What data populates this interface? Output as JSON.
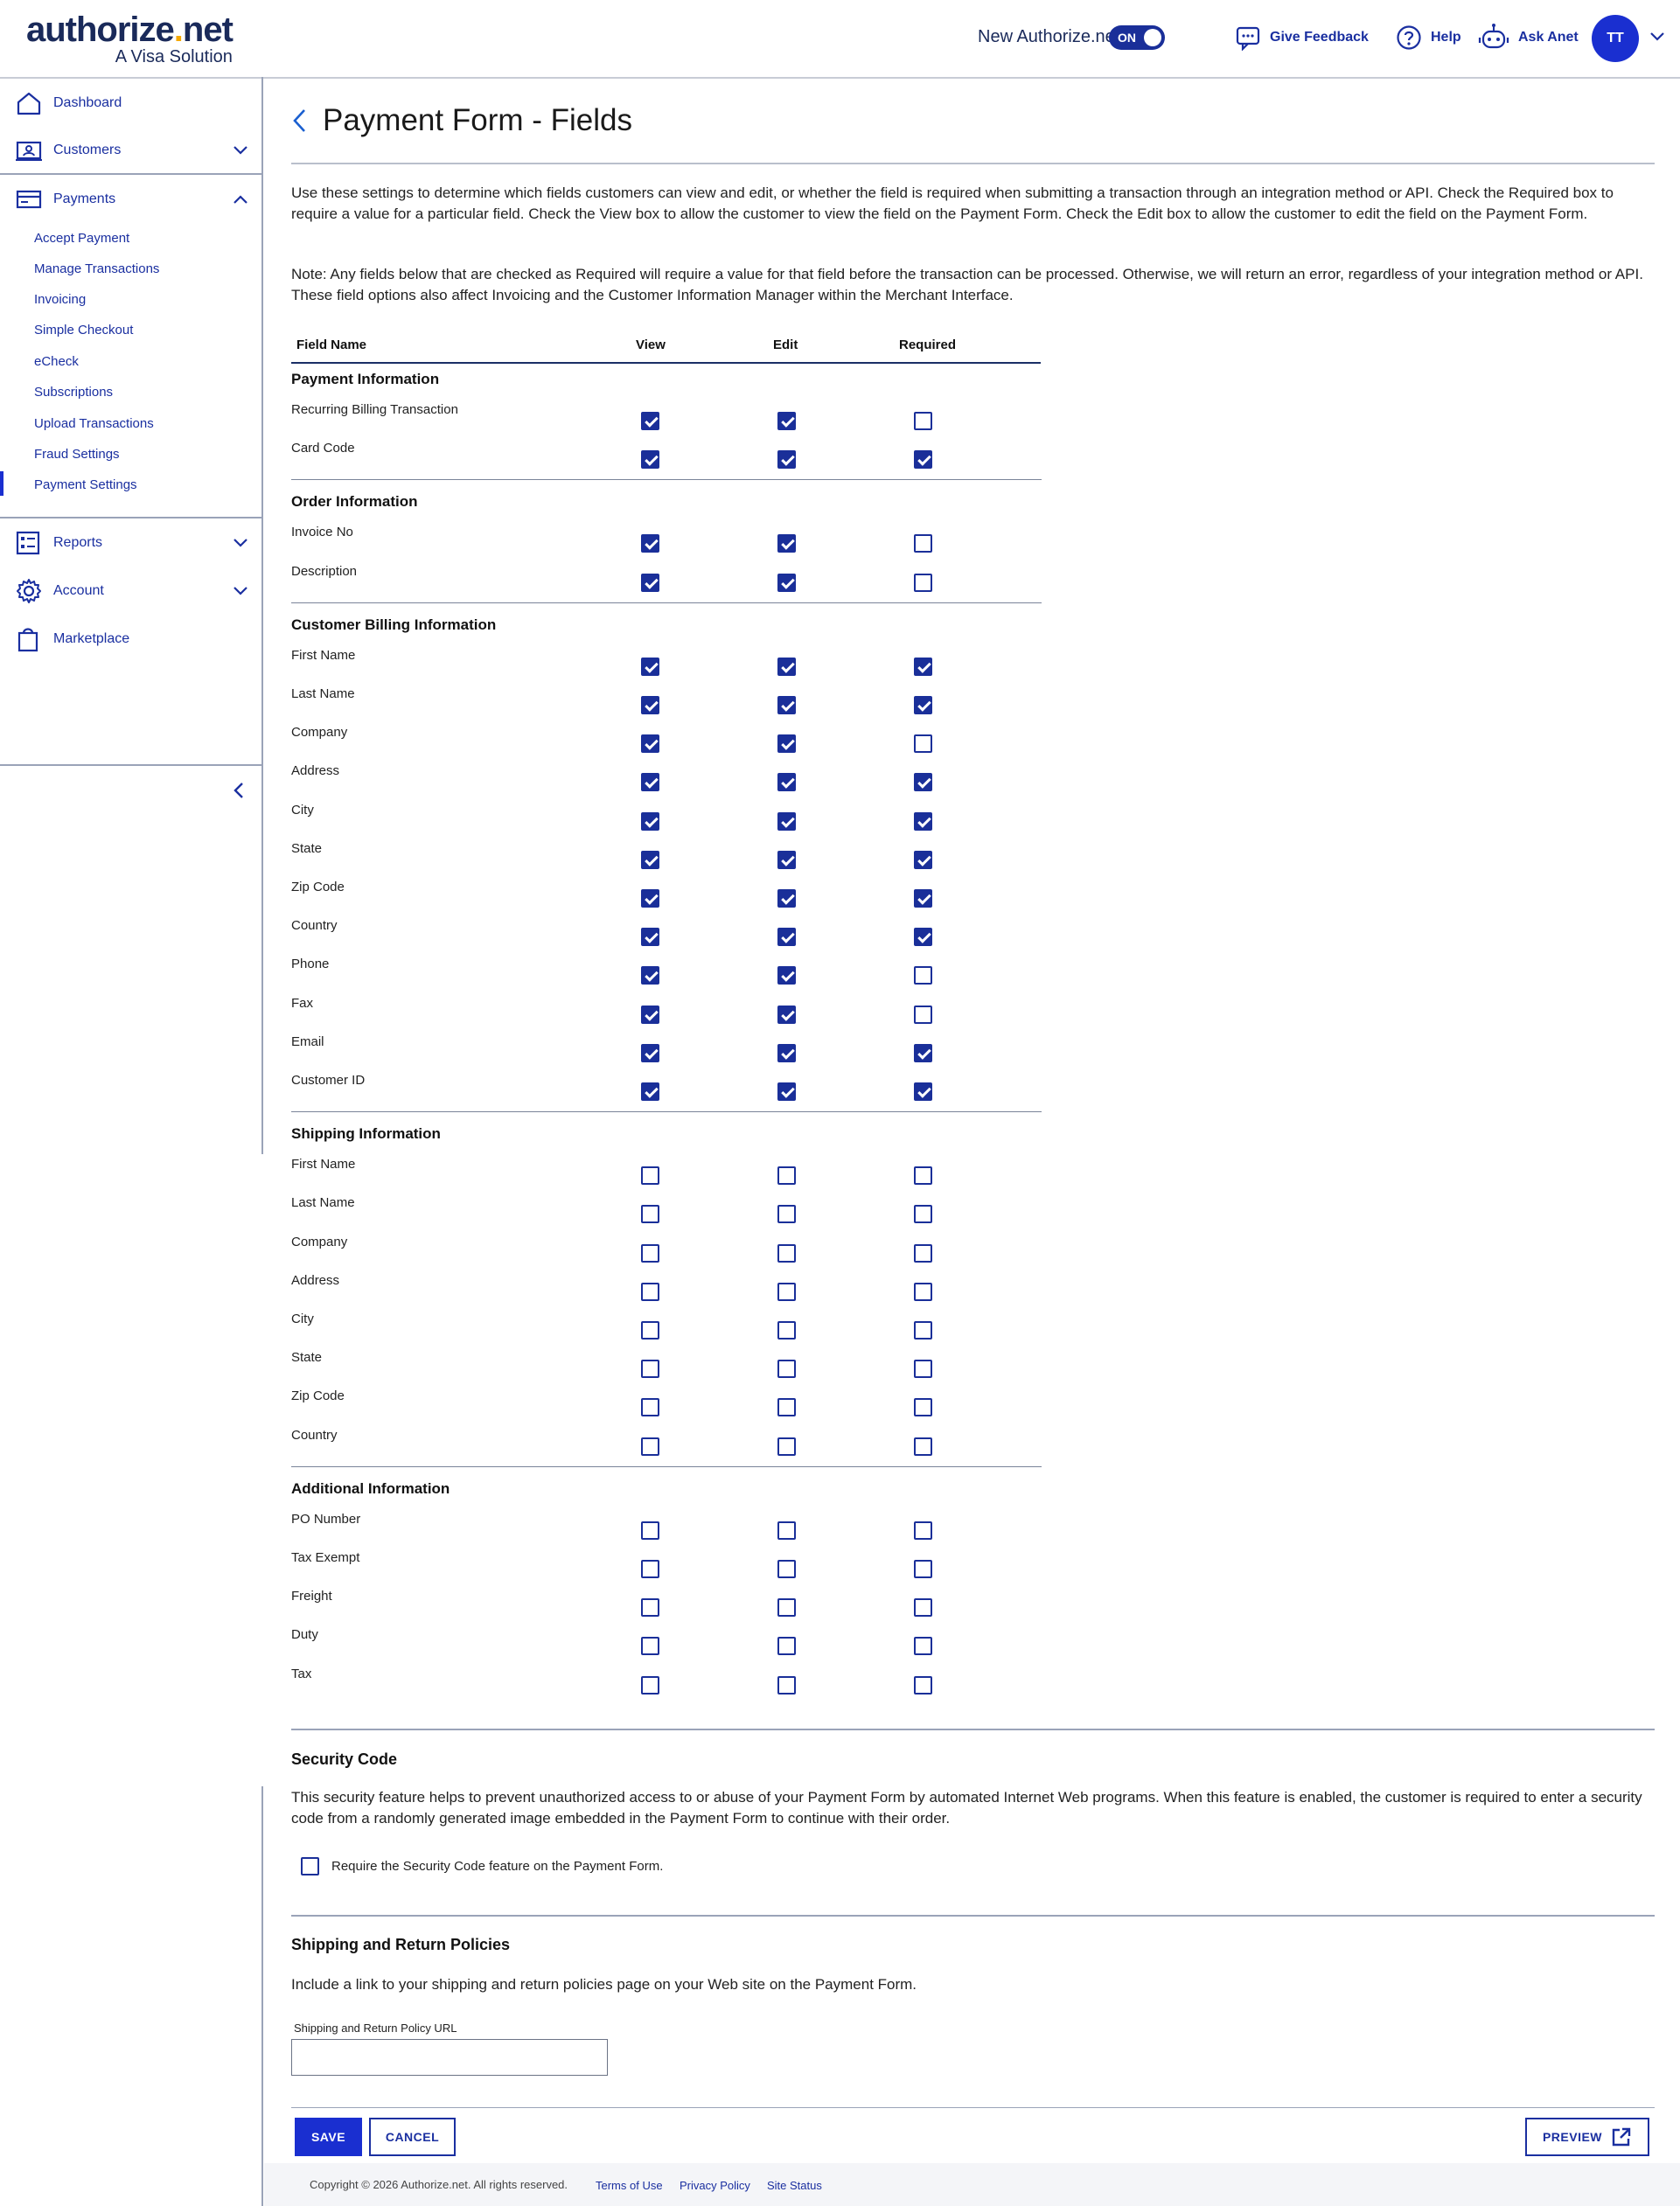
{
  "brand": {
    "name_part1": "authorize",
    "name_dot": ".",
    "name_part2": "net",
    "tagline": "A Visa Solution"
  },
  "topbar": {
    "new_label": "New Authorize.net",
    "toggle_label": "ON",
    "feedback": "Give Feedback",
    "help": "Help",
    "ask": "Ask Anet",
    "avatar_initials": "TT"
  },
  "sidebar": {
    "dashboard": "Dashboard",
    "customers": "Customers",
    "payments": "Payments",
    "payments_sub": [
      "Accept Payment",
      "Manage Transactions",
      "Invoicing",
      "Simple Checkout",
      "eCheck",
      "Subscriptions",
      "Upload Transactions",
      "Fraud Settings",
      "Payment Settings"
    ],
    "reports": "Reports",
    "account": "Account",
    "marketplace": "Marketplace"
  },
  "page": {
    "title": "Payment Form - Fields",
    "intro1": "Use these settings to determine which fields customers can view and edit, or whether the field is required when submitting a transaction through an integration method or API. Check the Required box to require a value for a particular field. Check the View box to allow the customer to view the field on the Payment Form. Check the Edit box to allow the customer to edit the field on the Payment Form.",
    "intro2": "Note: Any fields below that are checked as Required will require a value for that field before the transaction can be processed. Otherwise, we will return an error, regardless of your integration method or API. These field options also affect Invoicing and the Customer Information Manager within the Merchant Interface."
  },
  "grid": {
    "col_field": "Field Name",
    "col_view": "View",
    "col_edit": "Edit",
    "col_required": "Required",
    "sections": [
      {
        "title": "Payment Information",
        "rows": [
          {
            "label": "Recurring Billing Transaction",
            "view": true,
            "edit": true,
            "required": false
          },
          {
            "label": "Card Code",
            "view": true,
            "edit": true,
            "required": true
          }
        ]
      },
      {
        "title": "Order Information",
        "rows": [
          {
            "label": "Invoice No",
            "view": true,
            "edit": true,
            "required": false
          },
          {
            "label": "Description",
            "view": true,
            "edit": true,
            "required": false
          }
        ]
      },
      {
        "title": "Customer Billing Information",
        "rows": [
          {
            "label": "First Name",
            "view": true,
            "edit": true,
            "required": true
          },
          {
            "label": "Last Name",
            "view": true,
            "edit": true,
            "required": true
          },
          {
            "label": "Company",
            "view": true,
            "edit": true,
            "required": false
          },
          {
            "label": "Address",
            "view": true,
            "edit": true,
            "required": true
          },
          {
            "label": "City",
            "view": true,
            "edit": true,
            "required": true
          },
          {
            "label": "State",
            "view": true,
            "edit": true,
            "required": true
          },
          {
            "label": "Zip Code",
            "view": true,
            "edit": true,
            "required": true
          },
          {
            "label": "Country",
            "view": true,
            "edit": true,
            "required": true
          },
          {
            "label": "Phone",
            "view": true,
            "edit": true,
            "required": false
          },
          {
            "label": "Fax",
            "view": true,
            "edit": true,
            "required": false
          },
          {
            "label": "Email",
            "view": true,
            "edit": true,
            "required": true
          },
          {
            "label": "Customer ID",
            "view": true,
            "edit": true,
            "required": true
          }
        ]
      },
      {
        "title": "Shipping Information",
        "rows": [
          {
            "label": "First Name",
            "view": false,
            "edit": false,
            "required": false
          },
          {
            "label": "Last Name",
            "view": false,
            "edit": false,
            "required": false
          },
          {
            "label": "Company",
            "view": false,
            "edit": false,
            "required": false
          },
          {
            "label": "Address",
            "view": false,
            "edit": false,
            "required": false
          },
          {
            "label": "City",
            "view": false,
            "edit": false,
            "required": false
          },
          {
            "label": "State",
            "view": false,
            "edit": false,
            "required": false
          },
          {
            "label": "Zip Code",
            "view": false,
            "edit": false,
            "required": false
          },
          {
            "label": "Country",
            "view": false,
            "edit": false,
            "required": false
          }
        ]
      },
      {
        "title": "Additional Information",
        "rows": [
          {
            "label": "PO Number",
            "view": false,
            "edit": false,
            "required": false
          },
          {
            "label": "Tax Exempt",
            "view": false,
            "edit": false,
            "required": false
          },
          {
            "label": "Freight",
            "view": false,
            "edit": false,
            "required": false
          },
          {
            "label": "Duty",
            "view": false,
            "edit": false,
            "required": false
          },
          {
            "label": "Tax",
            "view": false,
            "edit": false,
            "required": false
          }
        ]
      }
    ]
  },
  "security": {
    "title": "Security Code",
    "desc": "This security feature helps to prevent unauthorized access to or abuse of your Payment Form by automated Internet Web programs. When this feature is enabled, the customer is required to enter a security code from a randomly generated image embedded in the Payment Form to continue with their order.",
    "checkbox_label": "Require the Security Code feature on the Payment Form.",
    "checked": false
  },
  "policies": {
    "title": "Shipping and Return Policies",
    "desc": "Include a link to your shipping and return policies page on your Web site on the Payment Form.",
    "url_label": "Shipping and Return Policy URL",
    "url_value": ""
  },
  "actions": {
    "save": "SAVE",
    "cancel": "CANCEL",
    "preview": "PREVIEW"
  },
  "footer": {
    "copyright": "Copyright © 2026 Authorize.net. All rights reserved.",
    "terms": "Terms of Use",
    "privacy": "Privacy Policy",
    "status": "Site Status"
  },
  "colors": {
    "accent": "#1a2fd0",
    "checkbox": "#1a2f99",
    "logo_dot": "#f6a800"
  }
}
